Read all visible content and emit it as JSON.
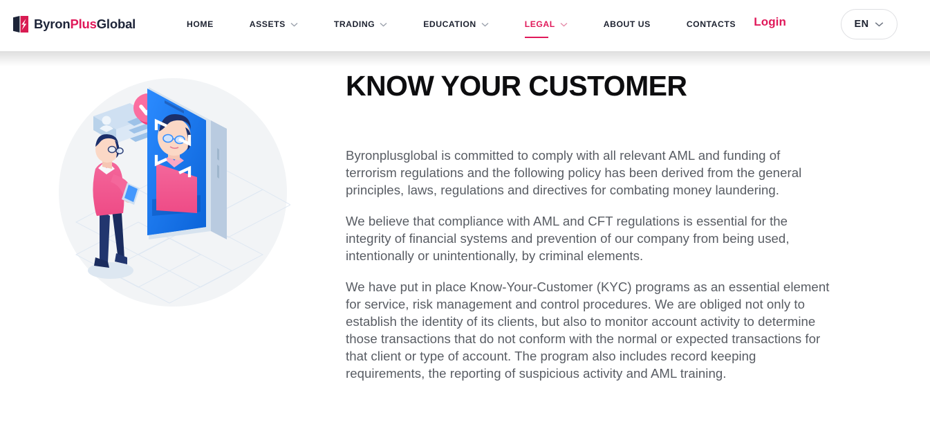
{
  "brand": {
    "name_part1": "Byron",
    "name_part2": "Plus",
    "name_part3": "Global",
    "accent_color": "#e0195a",
    "dark_color": "#1d2438"
  },
  "nav": {
    "items": [
      {
        "label": "HOME",
        "has_dropdown": false,
        "active": false
      },
      {
        "label": "ASSETS",
        "has_dropdown": true,
        "active": false
      },
      {
        "label": "TRADING",
        "has_dropdown": true,
        "active": false
      },
      {
        "label": "EDUCATION",
        "has_dropdown": true,
        "active": false
      },
      {
        "label": "LEGAL",
        "has_dropdown": true,
        "active": true
      },
      {
        "label": "ABOUT US",
        "has_dropdown": false,
        "active": false
      },
      {
        "label": "CONTACTS",
        "has_dropdown": false,
        "active": false
      }
    ]
  },
  "header": {
    "login_label": "Login",
    "language_label": "EN"
  },
  "main": {
    "title": "KNOW YOUR CUSTOMER",
    "paragraphs": [
      "Byronplusglobal is committed to comply with all relevant AML and funding of terrorism regulations and the following policy has been derived from the general principles, laws, regulations and directives for combating money laundering.",
      "We believe that compliance with AML and CFT regulations is essential for the integrity of financial systems and prevention of our company from being used, intentionally or unintentionally, by criminal elements.",
      "We have put in place Know-Your-Customer (KYC) programs as an essential element for service, risk management and control procedures. We are obliged not only to establish the identity of its clients, but also to monitor account activity to determine those transactions that do not conform with the normal or expected transactions for that client or type of account. The program also includes record keeping requirements, the reporting of suspicious activity and AML training."
    ],
    "illustration_name": "kyc-identity-verification-illustration"
  }
}
